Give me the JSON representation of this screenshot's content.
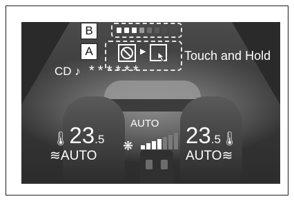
{
  "audio": {
    "source_label": "CD",
    "note_icon": "music-note-icon",
    "title_text": "******"
  },
  "climate": {
    "driver_temp_main": "23",
    "driver_temp_decimal": ".5",
    "passenger_temp_main": "23",
    "passenger_temp_decimal": ".5",
    "driver_mode": "AUTO",
    "passenger_mode": "AUTO",
    "fan_label": "AUTO",
    "fan_level": 4,
    "fan_level_max": 7
  },
  "shortcut": {
    "hold_label": "Touch and Hold"
  },
  "callouts": {
    "a": "A",
    "b": "B"
  },
  "colors": {
    "screen": "#3a3a3a",
    "text": "#ffffff",
    "callout_border": "#1a1a1a"
  }
}
